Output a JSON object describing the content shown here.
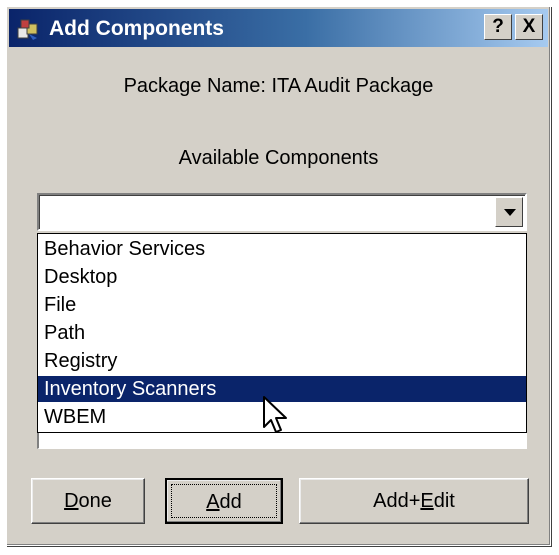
{
  "window": {
    "title": "Add Components",
    "help_button": "?",
    "close_button": "X"
  },
  "package_name_label": "Package Name: ITA Audit Package",
  "available_label": "Available Components",
  "combo": {
    "value": ""
  },
  "dropdown": {
    "items": [
      {
        "label": "Behavior Services",
        "selected": false
      },
      {
        "label": "Desktop",
        "selected": false
      },
      {
        "label": "File",
        "selected": false
      },
      {
        "label": "Path",
        "selected": false
      },
      {
        "label": "Registry",
        "selected": false
      },
      {
        "label": "Inventory Scanners",
        "selected": true
      },
      {
        "label": "WBEM",
        "selected": false
      }
    ]
  },
  "buttons": {
    "done": {
      "mnemonic": "D",
      "rest": "one"
    },
    "add": {
      "mnemonic": "A",
      "rest": "dd"
    },
    "addedit": {
      "prefix": "Add+",
      "mnemonic": "E",
      "rest": "dit"
    }
  },
  "colors": {
    "selection": "#0a246a",
    "dialog_face": "#d4d0c8"
  }
}
